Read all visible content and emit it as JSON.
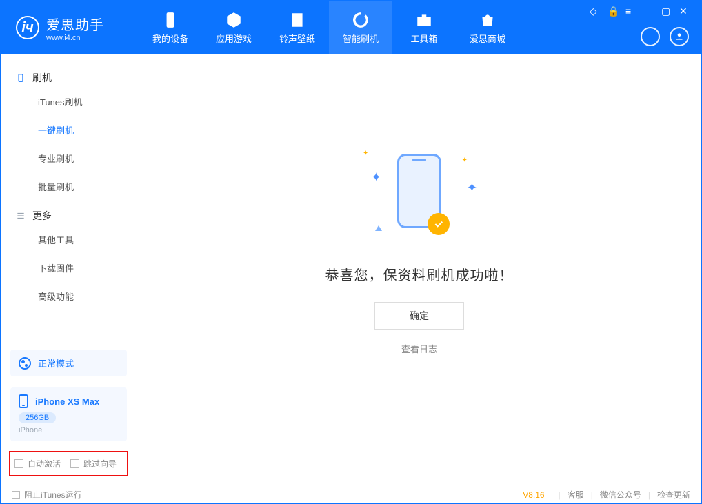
{
  "brand": {
    "name_cn": "爱思助手",
    "name_en": "www.i4.cn"
  },
  "nav": {
    "items": [
      {
        "label": "我的设备"
      },
      {
        "label": "应用游戏"
      },
      {
        "label": "铃声壁纸"
      },
      {
        "label": "智能刷机"
      },
      {
        "label": "工具箱"
      },
      {
        "label": "爱思商城"
      }
    ]
  },
  "sidebar": {
    "groups": [
      {
        "title": "刷机",
        "items": [
          "iTunes刷机",
          "一键刷机",
          "专业刷机",
          "批量刷机"
        ],
        "active_index": 1
      },
      {
        "title": "更多",
        "items": [
          "其他工具",
          "下载固件",
          "高级功能"
        ],
        "active_index": -1
      }
    ],
    "mode": "正常模式",
    "device": {
      "name": "iPhone XS Max",
      "storage": "256GB",
      "type": "iPhone"
    },
    "options": {
      "auto_activate": "自动激活",
      "skip_guide": "跳过向导"
    }
  },
  "main": {
    "success": "恭喜您，保资料刷机成功啦！",
    "ok": "确定",
    "view_log": "查看日志"
  },
  "footer": {
    "block_itunes": "阻止iTunes运行",
    "version": "V8.16",
    "links": [
      "客服",
      "微信公众号",
      "检查更新"
    ]
  }
}
